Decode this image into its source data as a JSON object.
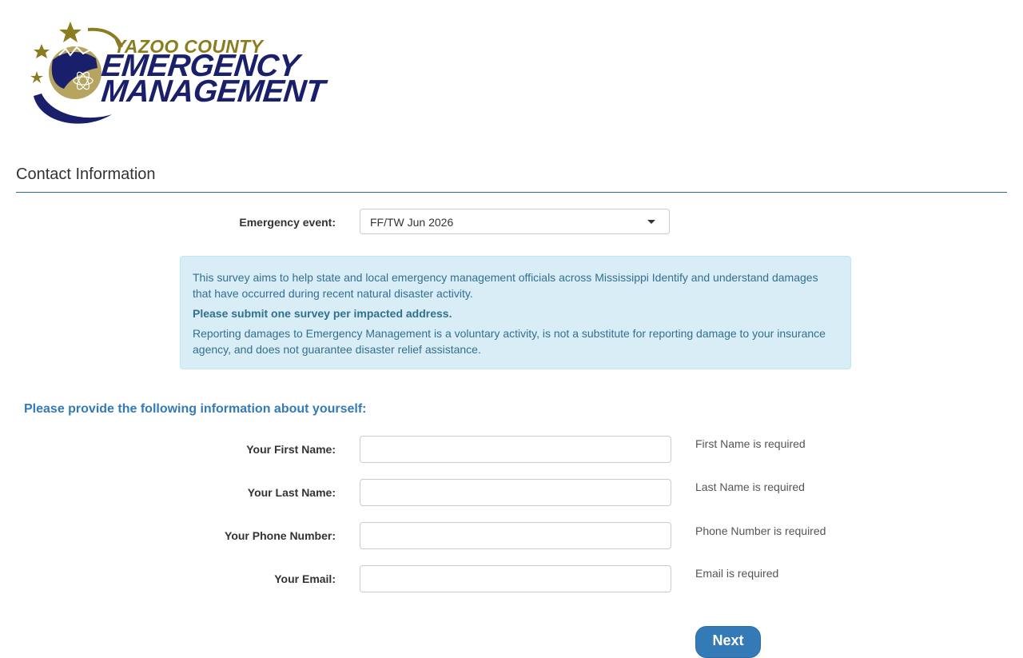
{
  "logo": {
    "line1": "YAZOO COUNTY",
    "line2": "EMERGENCY",
    "line3": "MANAGEMENT",
    "colors": {
      "gold": "#8a7d1f",
      "navy": "#1a1f6b"
    }
  },
  "section": {
    "title": "Contact Information"
  },
  "event": {
    "label": "Emergency event:",
    "selected": "FF/TW Jun 2026"
  },
  "info": {
    "p1": "This survey aims to help state and local emergency management officials across Mississippi Identify and understand damages that have occurred during recent natural disaster activity.",
    "p2": "Please submit one survey per impacted address.",
    "p3": "Reporting damages to Emergency Management is a voluntary activity, is not a substitute for reporting damage to your insurance agency, and does not guarantee disaster relief assistance."
  },
  "form": {
    "heading": "Please provide the following information about yourself:",
    "fields": [
      {
        "label": "Your First Name:",
        "value": "",
        "help": "First Name is required"
      },
      {
        "label": "Your Last Name:",
        "value": "",
        "help": "Last Name is required"
      },
      {
        "label": "Your Phone Number:",
        "value": "",
        "help": "Phone Number is required"
      },
      {
        "label": "Your Email:",
        "value": "",
        "help": "Email is required"
      }
    ],
    "next_label": "Next"
  },
  "colors": {
    "accent": "#337ab7",
    "rule": "#2c6c8c",
    "info_bg": "#d9edf7",
    "info_text": "#31708f"
  },
  "icons": [
    "stars-icon",
    "globe-icon",
    "dropdown-caret-icon"
  ]
}
